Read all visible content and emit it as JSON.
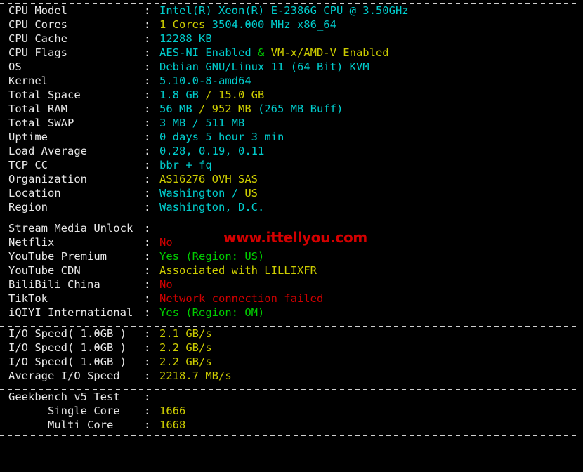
{
  "theme": {
    "background": "#000000",
    "label_color": "#e8e8e8",
    "cyan": "#00cdcd",
    "yellow": "#cdcd00",
    "green": "#00cd00",
    "red": "#cd0000",
    "separator_color": "#cfcfcf"
  },
  "watermark": {
    "text": "www.ittellyou.com",
    "color": "#d40000"
  },
  "separator": "- - - - - - - - - - - - - - - - - - - - - - - - - - - - - - - - - - - - - - -",
  "colon": ":",
  "sections": {
    "system": {
      "rows": [
        {
          "label": "CPU Model",
          "parts": [
            {
              "text": "Intel(R) Xeon(R) E-2386G CPU @ 3.50GHz",
              "color": "cyan"
            }
          ]
        },
        {
          "label": "CPU Cores",
          "parts": [
            {
              "text": "1 Cores ",
              "color": "yellow"
            },
            {
              "text": "3504.000 MHz x86_64",
              "color": "cyan"
            }
          ]
        },
        {
          "label": "CPU Cache",
          "parts": [
            {
              "text": "12288 KB",
              "color": "cyan"
            }
          ]
        },
        {
          "label": "CPU Flags",
          "parts": [
            {
              "text": "AES-NI Enabled ",
              "color": "cyan"
            },
            {
              "text": "& ",
              "color": "green"
            },
            {
              "text": "VM-x/AMD-V Enabled",
              "color": "yellow"
            }
          ]
        },
        {
          "label": "OS",
          "parts": [
            {
              "text": "Debian GNU/Linux 11 (64 Bit) KVM",
              "color": "cyan"
            }
          ]
        },
        {
          "label": "Kernel",
          "parts": [
            {
              "text": "5.10.0-8-amd64",
              "color": "cyan"
            }
          ]
        },
        {
          "label": "Total Space",
          "parts": [
            {
              "text": "1.8 GB ",
              "color": "cyan"
            },
            {
              "text": "/ 15.0 GB",
              "color": "yellow"
            }
          ]
        },
        {
          "label": "Total RAM",
          "parts": [
            {
              "text": "56 MB ",
              "color": "cyan"
            },
            {
              "text": "/ 952 MB ",
              "color": "yellow"
            },
            {
              "text": "(265 MB Buff)",
              "color": "cyan"
            }
          ]
        },
        {
          "label": "Total SWAP",
          "parts": [
            {
              "text": "3 MB / 511 MB",
              "color": "cyan"
            }
          ]
        },
        {
          "label": "Uptime",
          "parts": [
            {
              "text": "0 days 5 hour 3 min",
              "color": "cyan"
            }
          ]
        },
        {
          "label": "Load Average",
          "parts": [
            {
              "text": "0.28, 0.19, 0.11",
              "color": "cyan"
            }
          ]
        },
        {
          "label": "TCP CC",
          "parts": [
            {
              "text": "bbr + fq",
              "color": "cyan"
            }
          ]
        },
        {
          "label": "Organization",
          "parts": [
            {
              "text": "AS16276 OVH SAS",
              "color": "yellow"
            }
          ]
        },
        {
          "label": "Location",
          "parts": [
            {
              "text": "Washington / ",
              "color": "cyan"
            },
            {
              "text": "US",
              "color": "yellow"
            }
          ]
        },
        {
          "label": "Region",
          "parts": [
            {
              "text": "Washington, D.C.",
              "color": "cyan"
            }
          ]
        }
      ]
    },
    "stream_media": {
      "rows": [
        {
          "label": "Stream Media Unlock",
          "parts": []
        },
        {
          "label": "Netflix",
          "parts": [
            {
              "text": "No",
              "color": "red"
            }
          ]
        },
        {
          "label": "YouTube Premium",
          "parts": [
            {
              "text": "Yes (Region: US)",
              "color": "green"
            }
          ]
        },
        {
          "label": "YouTube CDN",
          "parts": [
            {
              "text": "Associated with LILLIXFR",
              "color": "yellow"
            }
          ]
        },
        {
          "label": "BiliBili China",
          "parts": [
            {
              "text": "No",
              "color": "red"
            }
          ]
        },
        {
          "label": "TikTok",
          "parts": [
            {
              "text": "Network connection failed",
              "color": "red"
            }
          ]
        },
        {
          "label": "iQIYI International",
          "parts": [
            {
              "text": "Yes (Region: OM)",
              "color": "green"
            }
          ]
        }
      ]
    },
    "io_speed": {
      "rows": [
        {
          "label": "I/O Speed( 1.0GB )",
          "parts": [
            {
              "text": "2.1 GB/s",
              "color": "yellow"
            }
          ]
        },
        {
          "label": "I/O Speed( 1.0GB )",
          "parts": [
            {
              "text": "2.2 GB/s",
              "color": "yellow"
            }
          ]
        },
        {
          "label": "I/O Speed( 1.0GB )",
          "parts": [
            {
              "text": "2.2 GB/s",
              "color": "yellow"
            }
          ]
        },
        {
          "label": "Average I/O Speed",
          "parts": [
            {
              "text": "2218.7 MB/s",
              "color": "yellow"
            }
          ]
        }
      ]
    },
    "geekbench": {
      "rows": [
        {
          "label": "Geekbench v5 Test",
          "parts": []
        },
        {
          "label": "      Single Core",
          "parts": [
            {
              "text": "1666",
              "color": "yellow"
            }
          ]
        },
        {
          "label": "      Multi Core",
          "parts": [
            {
              "text": "1668",
              "color": "yellow"
            }
          ]
        }
      ]
    }
  }
}
